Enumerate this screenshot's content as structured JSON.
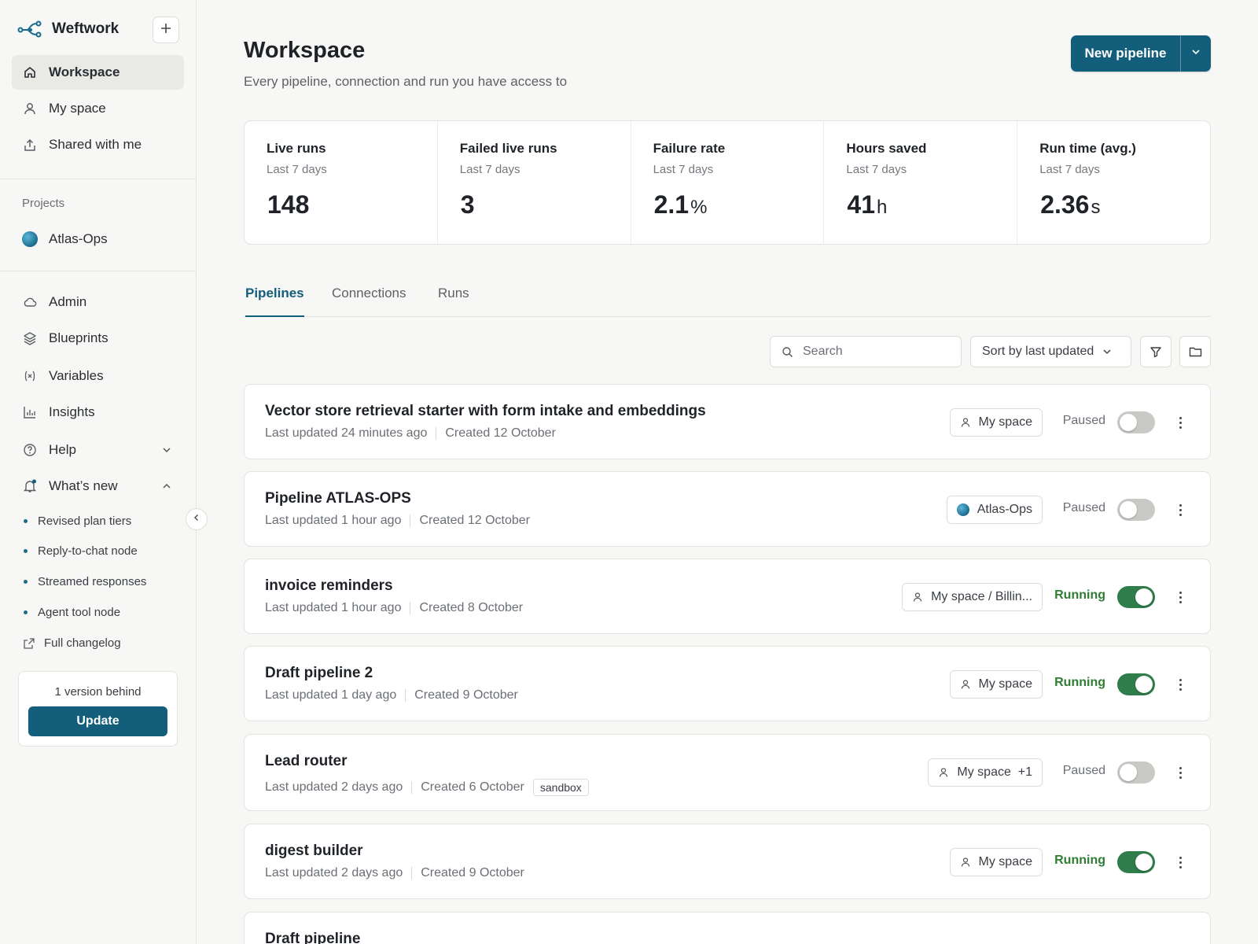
{
  "app": {
    "name": "Weftwork"
  },
  "sidebar": {
    "nav": [
      {
        "label": "Workspace",
        "icon": "home-icon",
        "active": true
      },
      {
        "label": "My space",
        "icon": "user-icon"
      },
      {
        "label": "Shared with me",
        "icon": "share-icon"
      }
    ],
    "projects_label": "Projects",
    "projects": [
      {
        "label": "Atlas-Ops"
      }
    ],
    "tools": [
      {
        "label": "Admin",
        "icon": "cloud-icon"
      },
      {
        "label": "Blueprints",
        "icon": "layers-icon"
      },
      {
        "label": "Variables",
        "icon": "variable-icon"
      },
      {
        "label": "Insights",
        "icon": "bar-chart-icon"
      },
      {
        "label": "Help",
        "icon": "help-icon"
      },
      {
        "label": "What’s new",
        "icon": "bell-icon"
      }
    ],
    "whats_new_items": [
      "Revised plan tiers",
      "Reply-to-chat node",
      "Streamed responses",
      "Agent tool node"
    ],
    "changelog_label": "Full changelog",
    "update_card": {
      "text": "1 version behind",
      "button": "Update"
    }
  },
  "header": {
    "title": "Workspace",
    "subtitle": "Every pipeline, connection and run you have access to",
    "new_button": "New pipeline"
  },
  "stats": [
    {
      "label": "Live runs",
      "period": "Last 7 days",
      "value": "148",
      "unit": ""
    },
    {
      "label": "Failed live runs",
      "period": "Last 7 days",
      "value": "3",
      "unit": ""
    },
    {
      "label": "Failure rate",
      "period": "Last 7 days",
      "value": "2.1",
      "unit": "%"
    },
    {
      "label": "Hours saved",
      "period": "Last 7 days",
      "value": "41",
      "unit": "h"
    },
    {
      "label": "Run time (avg.)",
      "period": "Last 7 days",
      "value": "2.36",
      "unit": "s"
    }
  ],
  "tabs": [
    {
      "label": "Pipelines",
      "active": true
    },
    {
      "label": "Connections"
    },
    {
      "label": "Runs"
    }
  ],
  "toolbar": {
    "search_placeholder": "Search",
    "sort_label": "Sort by last updated"
  },
  "pipelines": [
    {
      "title": "Vector store retrieval starter with form intake and embeddings",
      "updated": "Last updated 24 minutes ago",
      "created": "Created 12 October",
      "tag": "",
      "space": "My space",
      "space_type": "user",
      "status": "Paused",
      "on": false
    },
    {
      "title": "Pipeline ATLAS-OPS",
      "updated": "Last updated 1 hour ago",
      "created": "Created 12 October",
      "tag": "",
      "space": "Atlas-Ops",
      "space_type": "project",
      "status": "Paused",
      "on": false
    },
    {
      "title": "invoice reminders",
      "updated": "Last updated 1 hour ago",
      "created": "Created 8 October",
      "tag": "",
      "space": "My space / Billin...",
      "space_type": "user",
      "status": "Running",
      "on": true
    },
    {
      "title": "Draft pipeline 2",
      "updated": "Last updated 1 day ago",
      "created": "Created 9 October",
      "tag": "",
      "space": "My space",
      "space_type": "user",
      "status": "Running",
      "on": true
    },
    {
      "title": "Lead router",
      "updated": "Last updated 2 days ago",
      "created": "Created 6 October",
      "tag": "sandbox",
      "space": "My space  +1",
      "space_type": "user",
      "status": "Paused",
      "on": false
    },
    {
      "title": "digest builder",
      "updated": "Last updated 2 days ago",
      "created": "Created 9 October",
      "tag": "",
      "space": "My space",
      "space_type": "user",
      "status": "Running",
      "on": true
    },
    {
      "title": "Draft pipeline",
      "updated": "",
      "created": "",
      "tag": "",
      "space": "",
      "space_type": "user",
      "status": "",
      "on": false
    }
  ],
  "colors": {
    "accent": "#135e7a",
    "running": "#2e7d32",
    "toggle_on": "#2f7d4a",
    "toggle_off": "#c9c9c6"
  }
}
